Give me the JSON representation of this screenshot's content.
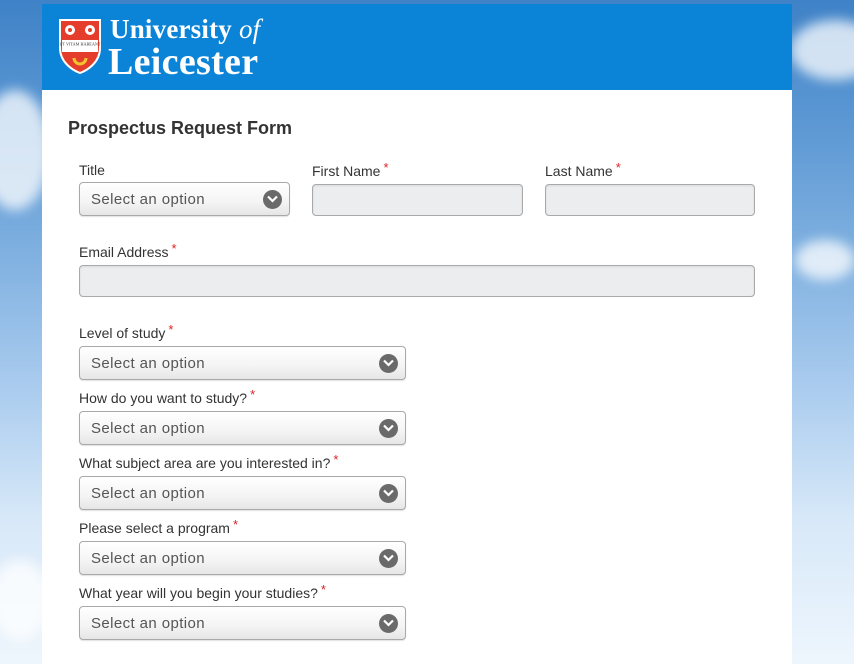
{
  "header": {
    "brand_word1": "University",
    "brand_word2": "of",
    "brand_line2": "Leicester",
    "crest_motto": "UT VITAM HABEANT",
    "color": "#0b84d8"
  },
  "form": {
    "title": "Prospectus Request Form",
    "required_mark": "*",
    "select_placeholder": "Select an option",
    "fields": {
      "title_label": "Title",
      "first_name_label": "First Name",
      "last_name_label": "Last Name",
      "email_label": "Email Address",
      "level_label": "Level of study",
      "how_label": "How do you want to study?",
      "subject_label": "What subject area are you interested in?",
      "program_label": "Please select a program",
      "year_label": "What year will you begin your studies?"
    }
  },
  "icons": {
    "dropdown": "chevron-down-icon",
    "crest": "university-crest-icon"
  }
}
